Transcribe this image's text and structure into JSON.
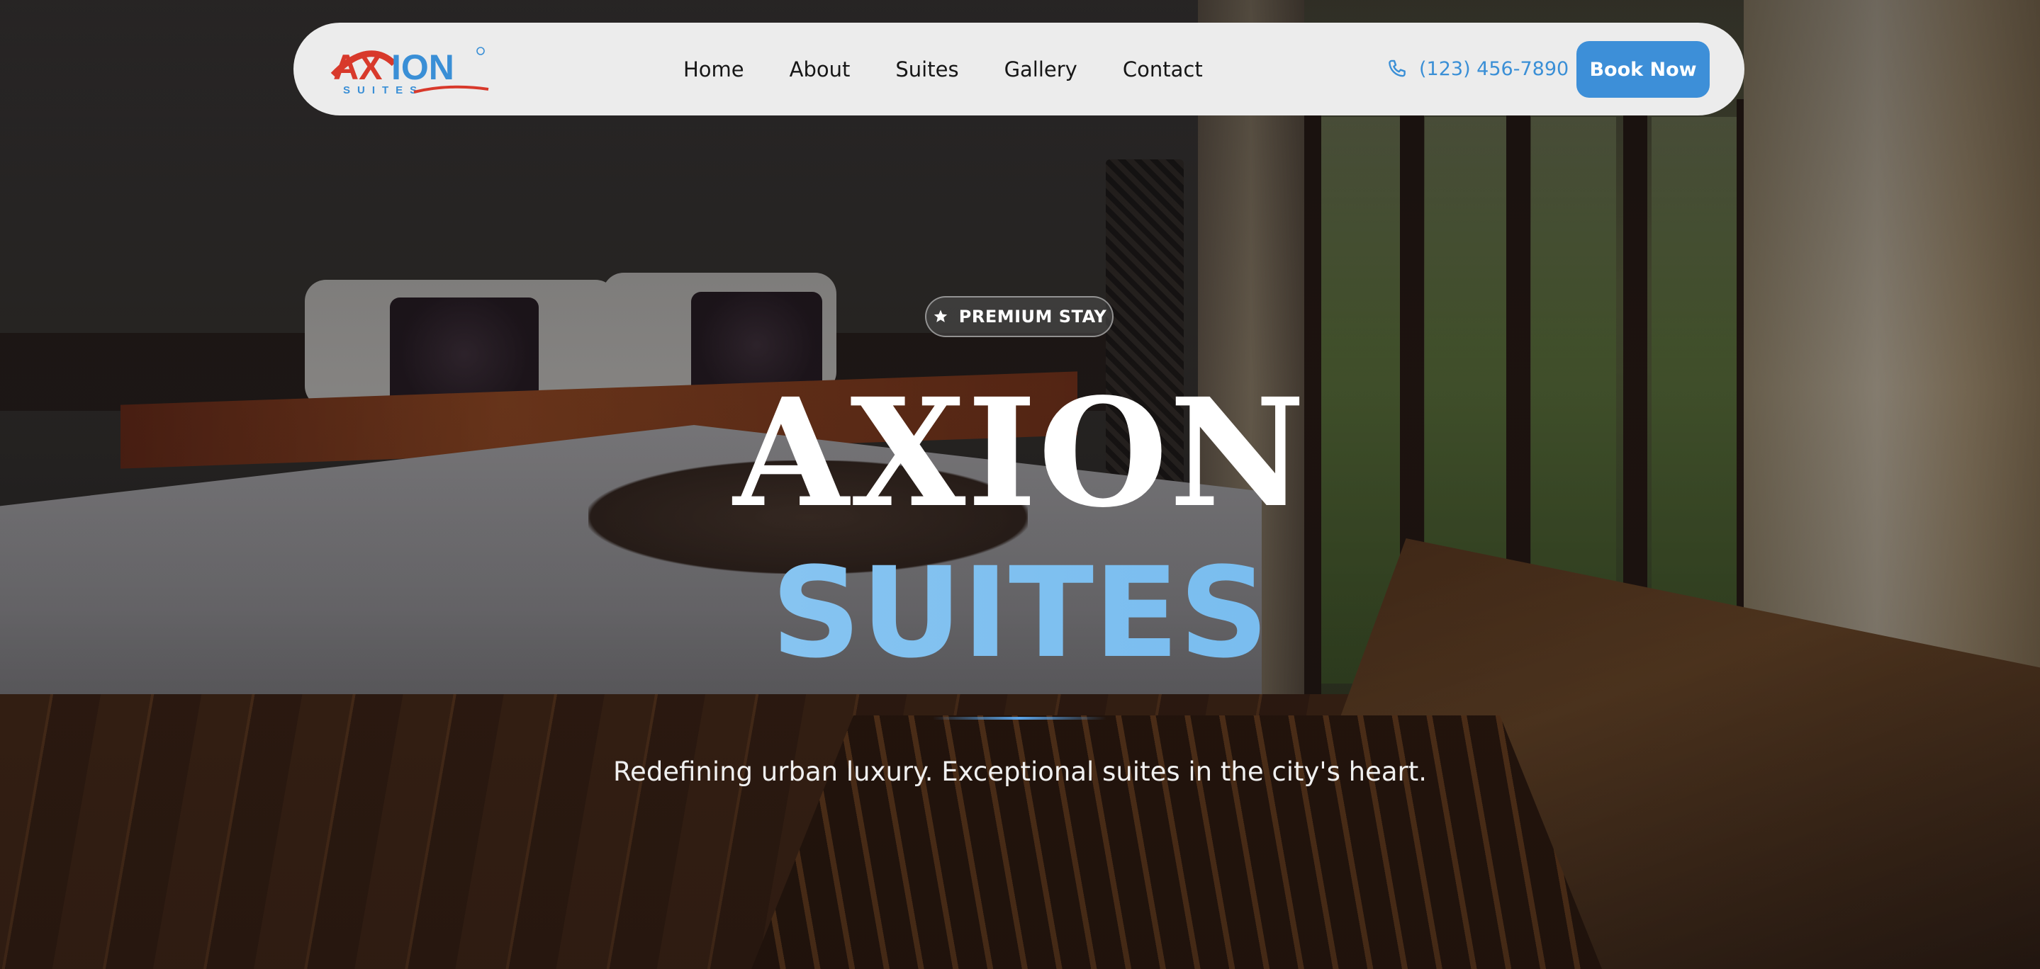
{
  "navbar": {
    "logo": {
      "wordmark": "AXION",
      "subtext": "SUITES",
      "icon": "axion-suites-logo",
      "colors": {
        "red": "#d8392b",
        "blue": "#3a8fd6"
      }
    },
    "links": [
      {
        "label": "Home"
      },
      {
        "label": "About"
      },
      {
        "label": "Suites"
      },
      {
        "label": "Gallery"
      },
      {
        "label": "Contact"
      }
    ],
    "phone": {
      "icon": "phone-icon",
      "number": "(123) 456-7890"
    },
    "cta_label": "Book Now"
  },
  "hero": {
    "badge": {
      "icon": "star-icon",
      "label": "PREMIUM STAY"
    },
    "title": "AXION",
    "subtitle": "SUITES",
    "tagline": "Redefining urban luxury. Exceptional suites in the city's heart."
  },
  "colors": {
    "accent": "#3d8fd8",
    "subtitle_gradient_start": "#9dd0f5",
    "subtitle_gradient_end": "#68b3ec",
    "navbar_bg": "#ececec"
  }
}
